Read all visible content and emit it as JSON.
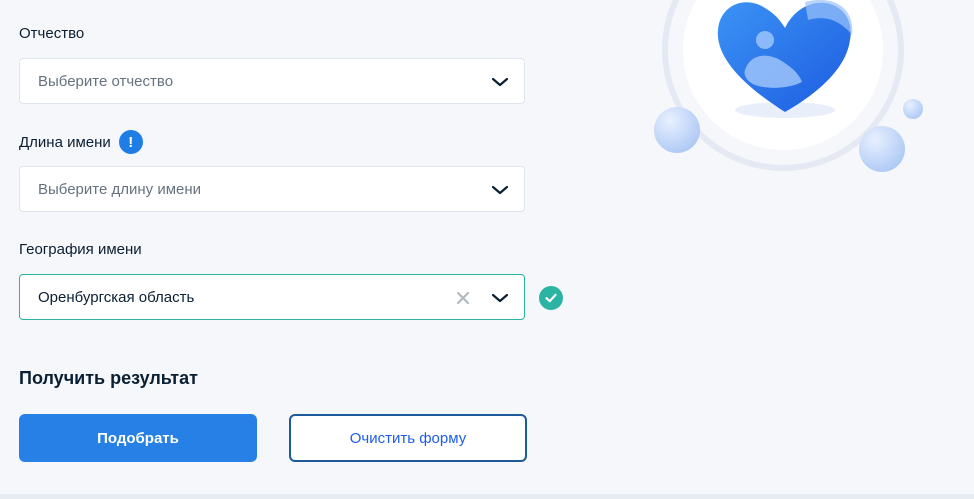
{
  "form": {
    "patronymic": {
      "label": "Отчество",
      "placeholder": "Выберите отчество"
    },
    "name_length": {
      "label": "Длина имени",
      "info_symbol": "!",
      "placeholder": "Выберите длину имени"
    },
    "name_geography": {
      "label": "География имени",
      "value": "Оренбургская область"
    }
  },
  "result": {
    "title": "Получить результат",
    "submit_label": "Подобрать",
    "clear_label": "Очистить форму"
  },
  "colors": {
    "primary": "#2680e6",
    "success": "#2bb3a4",
    "background": "#f5f7fa",
    "text": "#0b1f33"
  },
  "icons": {
    "illustration": "mother-child-heart-icon",
    "dropdown": "chevron-down-icon",
    "clear": "close-icon",
    "valid": "check-circle-icon"
  }
}
